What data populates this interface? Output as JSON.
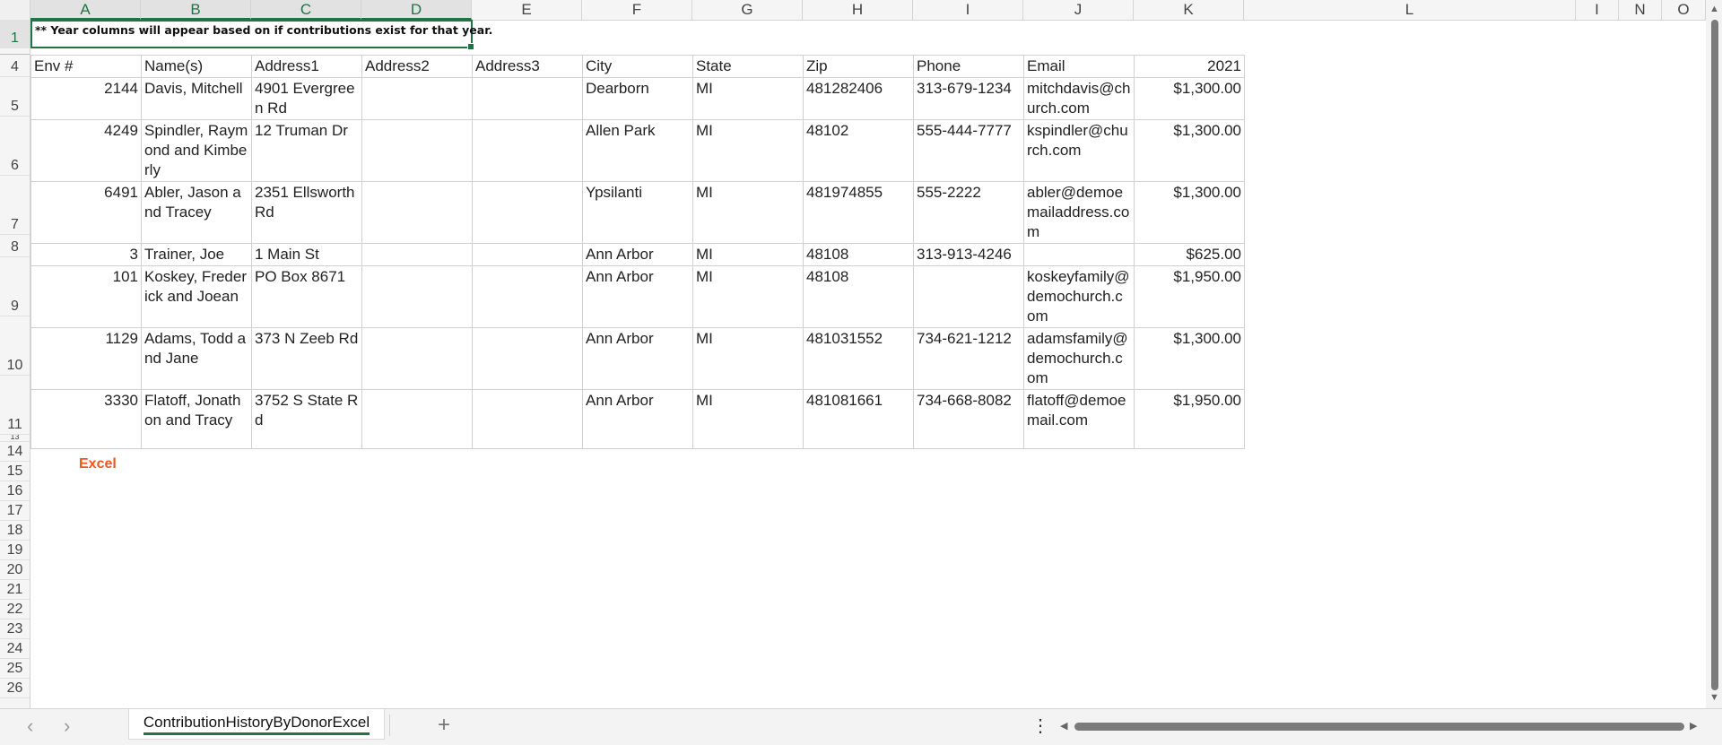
{
  "columns": [
    "A",
    "B",
    "C",
    "D",
    "E",
    "F",
    "G",
    "H",
    "I",
    "J",
    "K",
    "L",
    "I",
    "N",
    "O"
  ],
  "rows": [
    "1",
    "4",
    "5",
    "6",
    "7",
    "8",
    "9",
    "10",
    "11",
    "13",
    "14",
    "15",
    "16",
    "17",
    "18",
    "19",
    "20",
    "21",
    "22",
    "23",
    "24",
    "25",
    "26"
  ],
  "banner_text": "** Year columns will appear based on if contributions exist for that year.",
  "table": {
    "headers": [
      "Env #",
      "Name(s)",
      "Address1",
      "Address2",
      "Address3",
      "City",
      "State",
      "Zip",
      "Phone",
      "Email",
      "2021"
    ],
    "rows": [
      [
        "2144",
        "Davis, Mitchell",
        "4901 Evergreen Rd",
        "",
        "",
        "Dearborn",
        "MI",
        "481282406",
        "313-679-1234",
        "mitchdavis@church.com",
        "$1,300.00"
      ],
      [
        "4249",
        "Spindler, Raymond and Kimberly",
        "12 Truman Dr",
        "",
        "",
        "Allen Park",
        "MI",
        "48102",
        "555-444-7777",
        "kspindler@church.com",
        "$1,300.00"
      ],
      [
        "6491",
        "Abler, Jason and Tracey",
        "2351 Ellsworth Rd",
        "",
        "",
        "Ypsilanti",
        "MI",
        "481974855",
        "555-2222",
        "abler@demoemailaddress.com",
        "$1,300.00"
      ],
      [
        "3",
        "Trainer, Joe",
        "1 Main St",
        "",
        "",
        "Ann Arbor",
        "MI",
        "48108",
        "313-913-4246",
        "",
        "$625.00"
      ],
      [
        "101",
        "Koskey, Frederick and Joean",
        "PO Box 8671",
        "",
        "",
        "Ann Arbor",
        "MI",
        "48108",
        "",
        "koskeyfamily@demochurch.com",
        "$1,950.00"
      ],
      [
        "1129",
        "Adams, Todd and Jane",
        "373 N Zeeb Rd",
        "",
        "",
        "Ann Arbor",
        "MI",
        "481031552",
        "734-621-1212",
        "adamsfamily@demochurch.com",
        "$1,300.00"
      ],
      [
        "3330",
        "Flatoff, Jonathon and Tracy",
        "3752 S State Rd",
        "",
        "",
        "Ann Arbor",
        "MI",
        "481081661",
        "734-668-8082",
        "flatoff@demoemail.com",
        "$1,950.00"
      ]
    ]
  },
  "excel_label": "Excel",
  "sheet_tab": "ContributionHistoryByDonorExcel",
  "add_sheet": "+",
  "nav_prev": "‹",
  "nav_next": "›",
  "more": "⋮",
  "accent": "#217346"
}
